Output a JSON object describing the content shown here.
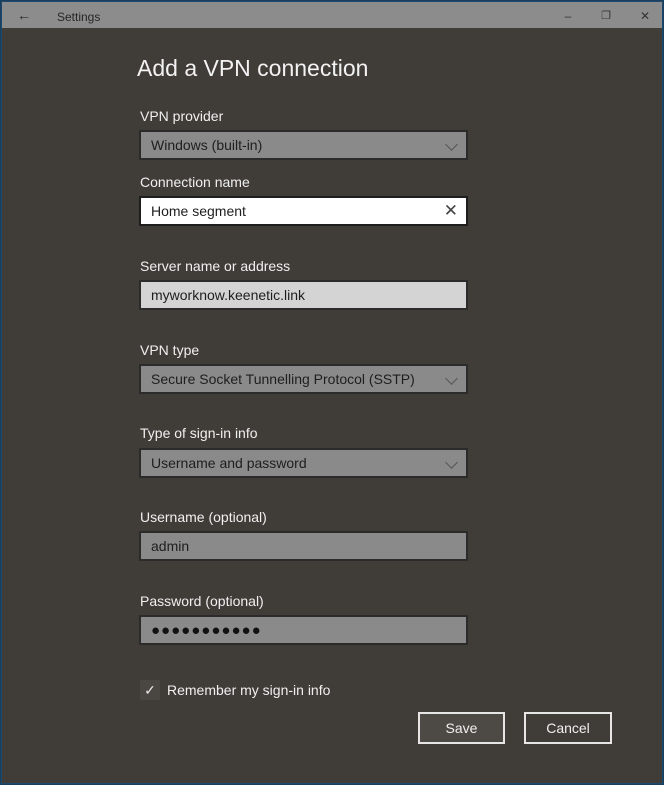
{
  "window": {
    "title": "Settings",
    "back_icon": "←",
    "minimize_icon": "–",
    "restore_icon": "❐",
    "close_icon": "✕"
  },
  "page": {
    "heading": "Add a VPN connection"
  },
  "form": {
    "vpn_provider": {
      "label": "VPN provider",
      "value": "Windows (built-in)"
    },
    "connection_name": {
      "label": "Connection name",
      "value": "Home segment",
      "clear_icon": "✕"
    },
    "server": {
      "label": "Server name or address",
      "value": "myworknow.keenetic.link"
    },
    "vpn_type": {
      "label": "VPN type",
      "value": "Secure Socket Tunnelling Protocol (SSTP)"
    },
    "signin_type": {
      "label": "Type of sign-in info",
      "value": "Username and password"
    },
    "username": {
      "label": "Username (optional)",
      "value": "admin"
    },
    "password": {
      "label": "Password (optional)",
      "value": "●●●●●●●●●●●"
    },
    "remember": {
      "label": "Remember my sign-in info",
      "checked": true,
      "check_icon": "✓"
    }
  },
  "buttons": {
    "save": "Save",
    "cancel": "Cancel"
  }
}
